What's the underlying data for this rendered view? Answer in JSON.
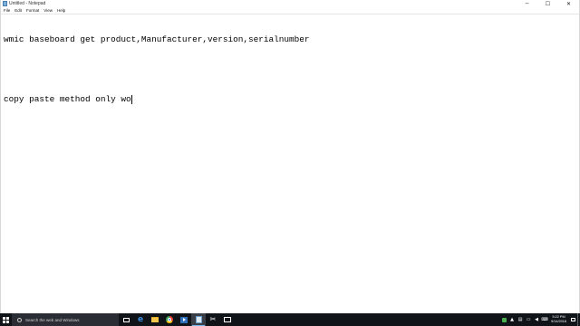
{
  "window": {
    "title": "Untitled - Notepad",
    "controls": {
      "minimize": "─",
      "maximize": "☐",
      "close": "✕"
    }
  },
  "menu": {
    "items": [
      "File",
      "Edit",
      "Format",
      "View",
      "Help"
    ]
  },
  "editor": {
    "lines": [
      "wmic baseboard get product,Manufacturer,version,serialnumber",
      "",
      "copy paste method only wo"
    ]
  },
  "taskbar": {
    "search_placeholder": "Search the web and Windows",
    "apps": [
      "task-view",
      "edge",
      "file-explorer",
      "chrome",
      "media-player",
      "notepad",
      "snipping-tool",
      "command-prompt"
    ],
    "active_app": "notepad",
    "tray_icons": [
      "network",
      "up-arrow",
      "battery",
      "volume",
      "keyboard"
    ],
    "clock": {
      "time": "5:22 PM",
      "date": "9/14/2016"
    }
  },
  "colors": {
    "taskbar_bg": "#101418",
    "accent": "#76b9ed",
    "editor_text": "#000000"
  }
}
